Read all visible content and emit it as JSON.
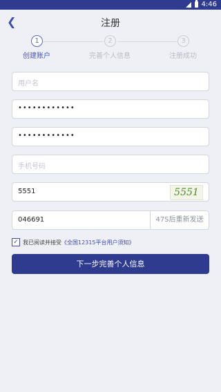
{
  "status_bar": {
    "time": "4:46"
  },
  "header": {
    "back_icon": "chevron-left-icon",
    "title": "注册"
  },
  "steps": [
    {
      "number": "1",
      "label": "创建账户",
      "state": "active"
    },
    {
      "number": "2",
      "label": "完善个人信息",
      "state": "inactive"
    },
    {
      "number": "3",
      "label": "注册成功",
      "state": "inactive"
    }
  ],
  "form": {
    "username": {
      "placeholder": "用户名",
      "value": ""
    },
    "password": {
      "value": "••••••••••••"
    },
    "confirm_password": {
      "value": "••••••••••••"
    },
    "phone": {
      "placeholder": "手机号码",
      "value": ""
    },
    "captcha": {
      "value": "5551",
      "image_text": "5551"
    },
    "sms_code": {
      "value": "046691",
      "resend_label": "47S后重新发送"
    }
  },
  "agreement": {
    "checked": true,
    "prefix": "我已阅读并接受",
    "link": "《全国12315平台用户须知》"
  },
  "submit_label": "下一步完善个人信息",
  "colors": {
    "primary": "#2f3b8e",
    "accent": "#5b67c6",
    "background": "#eef0f5"
  }
}
